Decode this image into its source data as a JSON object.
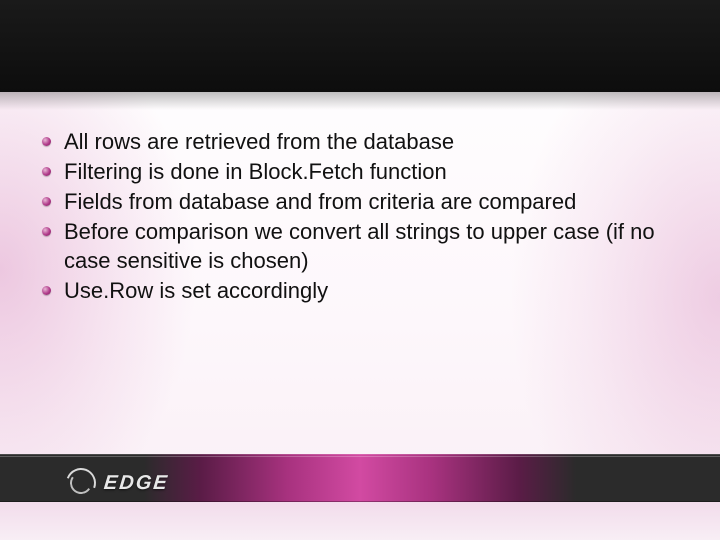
{
  "bullets": [
    "All rows are retrieved from the database",
    "Filtering is done in Block.Fetch function",
    "Fields from database and from criteria are compared",
    "Before comparison we convert all strings to upper case (if no case sensitive is chosen)",
    "Use.Row is set accordingly"
  ],
  "brand": {
    "name": "EDGE"
  }
}
